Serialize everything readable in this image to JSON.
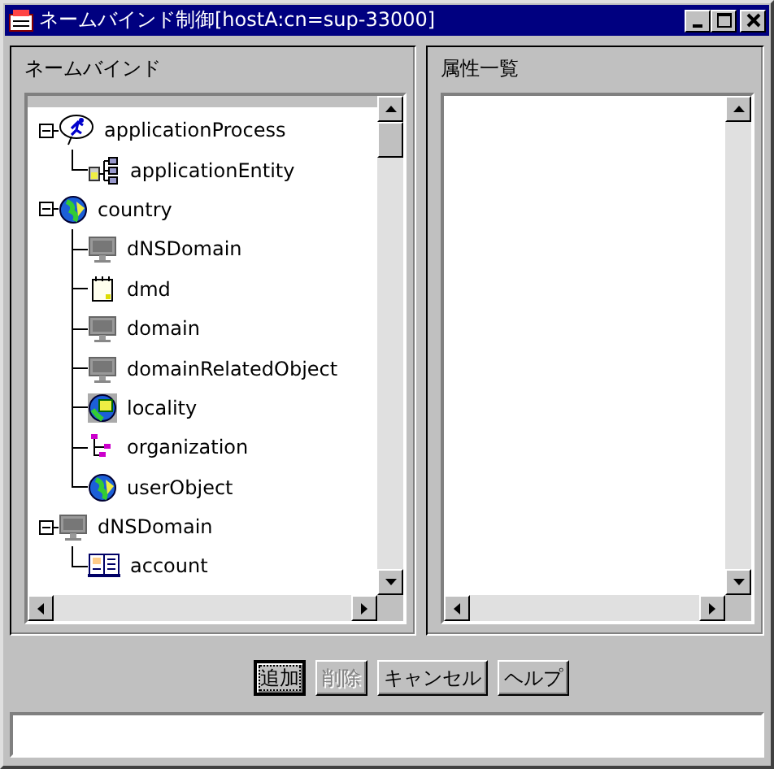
{
  "window": {
    "title": "ネームバインド制御[hostA:cn=sup-33000]"
  },
  "left_panel": {
    "title": "ネームバインド",
    "tree": [
      {
        "label": "applicationProcess",
        "kind": "process",
        "expanded": true,
        "children": [
          {
            "label": "applicationEntity",
            "kind": "entity"
          }
        ]
      },
      {
        "label": "country",
        "kind": "globe",
        "expanded": true,
        "children": [
          {
            "label": "dNSDomain",
            "kind": "monitor"
          },
          {
            "label": "dmd",
            "kind": "note"
          },
          {
            "label": "domain",
            "kind": "monitor"
          },
          {
            "label": "domainRelatedObject",
            "kind": "monitor"
          },
          {
            "label": "locality",
            "kind": "locality"
          },
          {
            "label": "organization",
            "kind": "org"
          },
          {
            "label": "userObject",
            "kind": "globe"
          }
        ]
      },
      {
        "label": "dNSDomain",
        "kind": "monitor",
        "expanded": true,
        "children": [
          {
            "label": "account",
            "kind": "book"
          }
        ]
      }
    ]
  },
  "right_panel": {
    "title": "属性一覧"
  },
  "buttons": [
    {
      "label": "追加",
      "disabled": false,
      "focused": true
    },
    {
      "label": "削除",
      "disabled": true,
      "focused": false
    },
    {
      "label": "キャンセル",
      "disabled": false,
      "focused": false
    },
    {
      "label": "ヘルプ",
      "disabled": false,
      "focused": false
    }
  ]
}
